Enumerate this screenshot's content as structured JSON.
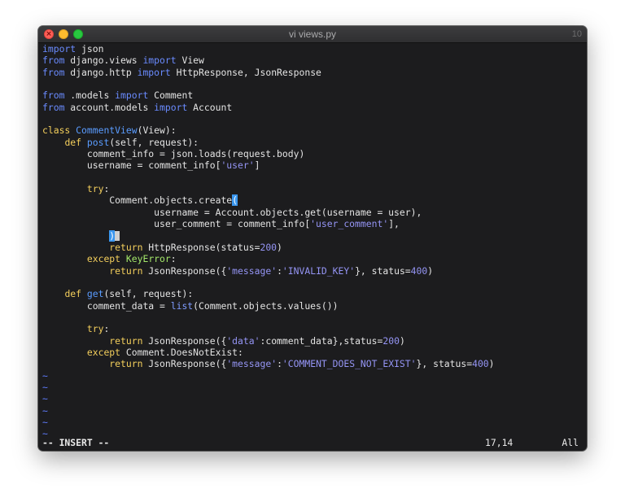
{
  "window": {
    "title": "vi views.py",
    "right_label": "10",
    "close_glyph": "×"
  },
  "code": {
    "l1": [
      "import",
      " json"
    ],
    "l2": [
      "from",
      " django.views ",
      "import",
      " View"
    ],
    "l3": [
      "from",
      " django.http ",
      "import",
      " HttpResponse, JsonResponse"
    ],
    "l5": [
      "from",
      " .models ",
      "import",
      " Comment"
    ],
    "l6": [
      "from",
      " account.models ",
      "import",
      " Account"
    ],
    "l8": [
      "class",
      " ",
      "CommentView",
      "(View):"
    ],
    "l9": [
      "    ",
      "def",
      " ",
      "post",
      "(self, request):"
    ],
    "l10": [
      "        comment_info = json.loads(request.body)"
    ],
    "l11": [
      "        username = comment_info[",
      "'user'",
      "]"
    ],
    "l13": [
      "        ",
      "try",
      ":"
    ],
    "l14": [
      "            Comment.objects.create",
      "("
    ],
    "l15": [
      "                    username = Account.objects.get(username = user),"
    ],
    "l16": [
      "                    user_comment = comment_info[",
      "'user_comment'",
      "],"
    ],
    "l17": [
      "            ",
      ")"
    ],
    "l18": [
      "            ",
      "return",
      " HttpResponse(status=",
      "200",
      ")"
    ],
    "l19": [
      "        ",
      "except",
      " ",
      "KeyError",
      ":"
    ],
    "l20": [
      "            ",
      "return",
      " JsonResponse({",
      "'message'",
      ":",
      "'INVALID_KEY'",
      "}, status=",
      "400",
      ")"
    ],
    "l22": [
      "    ",
      "def",
      " ",
      "get",
      "(self, request):"
    ],
    "l23": [
      "        comment_data = ",
      "list",
      "(Comment.objects.values())"
    ],
    "l25": [
      "        ",
      "try",
      ":"
    ],
    "l26": [
      "            ",
      "return",
      " JsonResponse({",
      "'data'",
      ":comment_data},status=",
      "200",
      ")"
    ],
    "l27": [
      "        ",
      "except",
      " Comment.DoesNotExist:"
    ],
    "l28": [
      "            ",
      "return",
      " JsonResponse({",
      "'message'",
      ":",
      "'COMMENT_DOES_NOT_EXIST'",
      "}, status=",
      "400",
      ")"
    ],
    "tilde": "~"
  },
  "status": {
    "mode": "-- INSERT --",
    "cursor_pos": "17,14",
    "scroll": "All"
  },
  "colors": {
    "background": "#1c1c1e",
    "keyword": "#6a8bff",
    "control": "#f4cf5c",
    "string": "#9595f5",
    "exception": "#a4e86a",
    "cursor_highlight": "#3a96ee"
  },
  "icons": [
    "close-icon",
    "minimize-icon",
    "zoom-icon"
  ]
}
